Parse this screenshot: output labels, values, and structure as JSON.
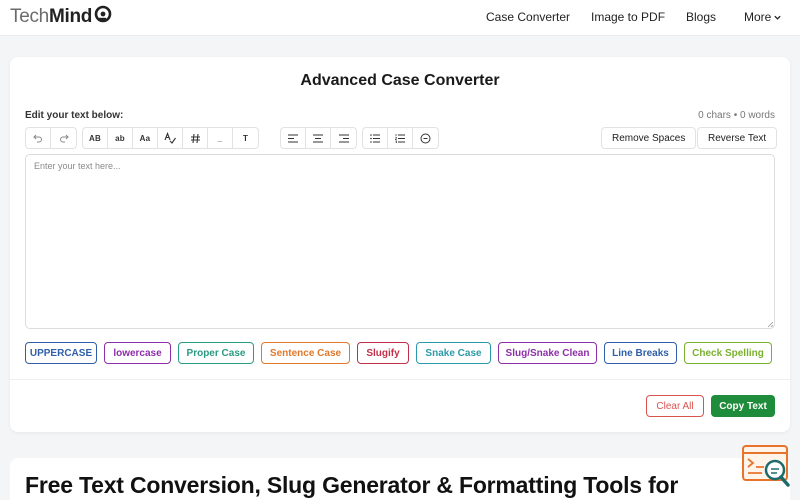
{
  "header": {
    "logo_part1": "Tech",
    "logo_part2": "Mind",
    "nav": [
      "Case Converter",
      "Image to PDF",
      "Blogs"
    ],
    "more_label": "More"
  },
  "converter": {
    "title": "Advanced Case Converter",
    "edit_label": "Edit your text below:",
    "counts": "0 chars • 0 words",
    "toolbar_text": {
      "upper": "AB",
      "lower": "ab",
      "title": "Aa",
      "underscore": "_",
      "text": "T"
    },
    "remove_spaces": "Remove Spaces",
    "reverse_text": "Reverse Text",
    "placeholder": "Enter your text here...",
    "buttons": [
      {
        "label": "UPPERCASE",
        "color": "#2e5fa8"
      },
      {
        "label": "lowercase",
        "color": "#8e2ea8"
      },
      {
        "label": "Proper Case",
        "color": "#2a9a82"
      },
      {
        "label": "Sentence Case",
        "color": "#e0782c"
      },
      {
        "label": "Slugify",
        "color": "#c0304a"
      },
      {
        "label": "Snake Case",
        "color": "#2a9aa8"
      },
      {
        "label": "Slug/Snake Clean",
        "color": "#8e2ea8"
      },
      {
        "label": "Line Breaks",
        "color": "#2e5fa8"
      },
      {
        "label": "Check Spelling",
        "color": "#7ab02e"
      }
    ],
    "clear_all": "Clear All",
    "copy_text": "Copy Text"
  },
  "section2": {
    "heading": "Free Text Conversion, Slug Generator & Formatting Tools for"
  },
  "colors": {
    "copy_green": "#1e8c3a",
    "clear_red": "#d9534f",
    "widget_orange": "#e8742c",
    "widget_teal": "#1e6b6b"
  }
}
